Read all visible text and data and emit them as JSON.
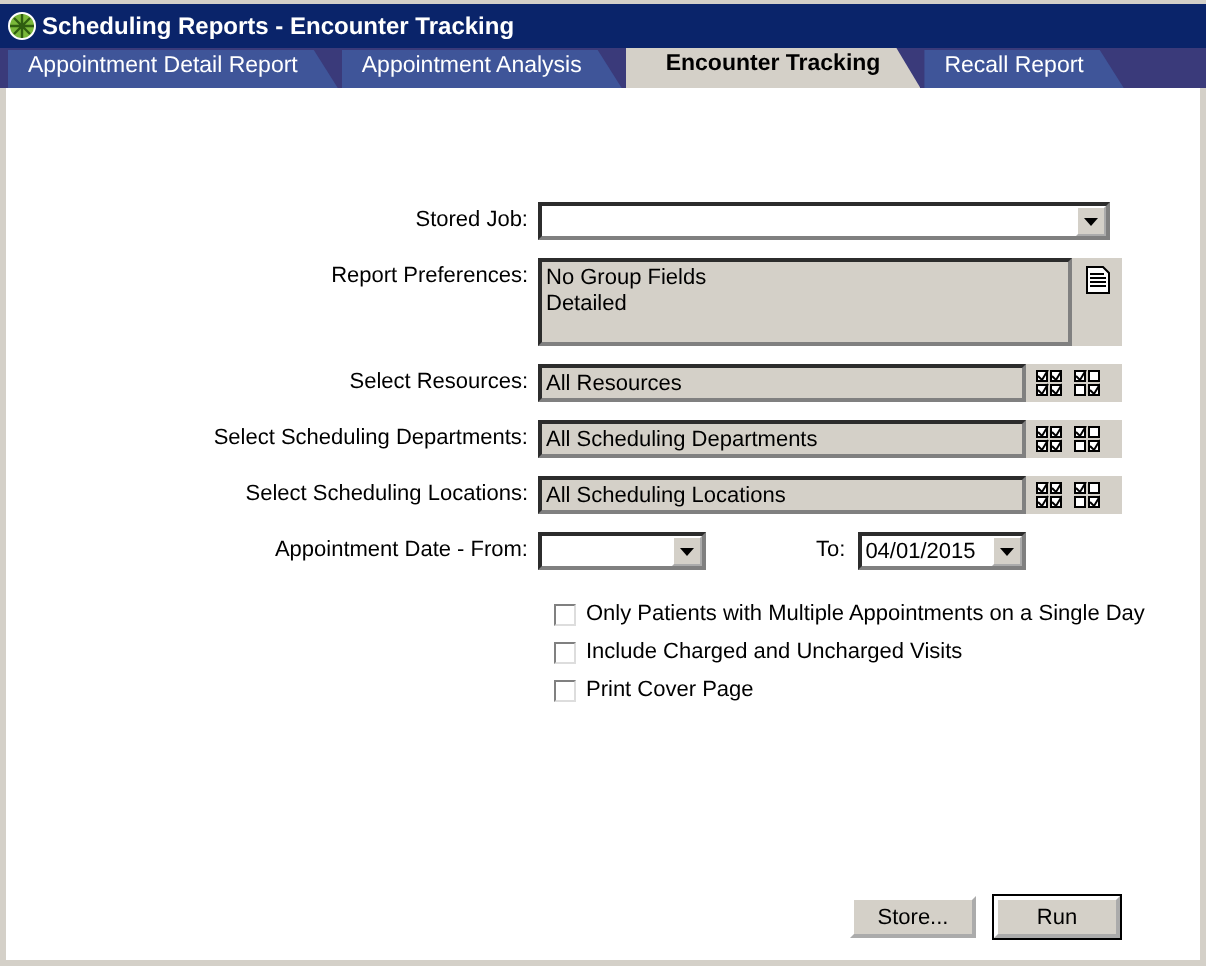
{
  "window": {
    "title": "Scheduling Reports - Encounter Tracking"
  },
  "tabs": [
    {
      "label": "Appointment Detail Report",
      "selected": false
    },
    {
      "label": "Appointment Analysis",
      "selected": false
    },
    {
      "label": "Encounter Tracking",
      "selected": true
    },
    {
      "label": "Recall Report",
      "selected": false
    }
  ],
  "stored_job": {
    "label": "Stored Job:"
  },
  "report_preferences": {
    "label": "Report Preferences:",
    "lines": [
      "No Group Fields",
      "Detailed"
    ]
  },
  "selections": [
    {
      "label": "Select Resources:",
      "value": "All Resources"
    },
    {
      "label": "Select Scheduling Departments:",
      "value": "All Scheduling Departments"
    },
    {
      "label": "Select Scheduling Locations:",
      "value": "All Scheduling Locations"
    }
  ],
  "date_range": {
    "from_label": "Appointment Date - From:",
    "to_label": "To:",
    "to_value": "04/01/2015"
  },
  "options": [
    {
      "label": "Only Patients with Multiple Appointments on a Single Day",
      "checked": false
    },
    {
      "label": "Include Charged and Uncharged Visits",
      "checked": false
    },
    {
      "label": "Print Cover Page",
      "checked": false
    }
  ],
  "buttons": [
    "Store...",
    "Run"
  ]
}
